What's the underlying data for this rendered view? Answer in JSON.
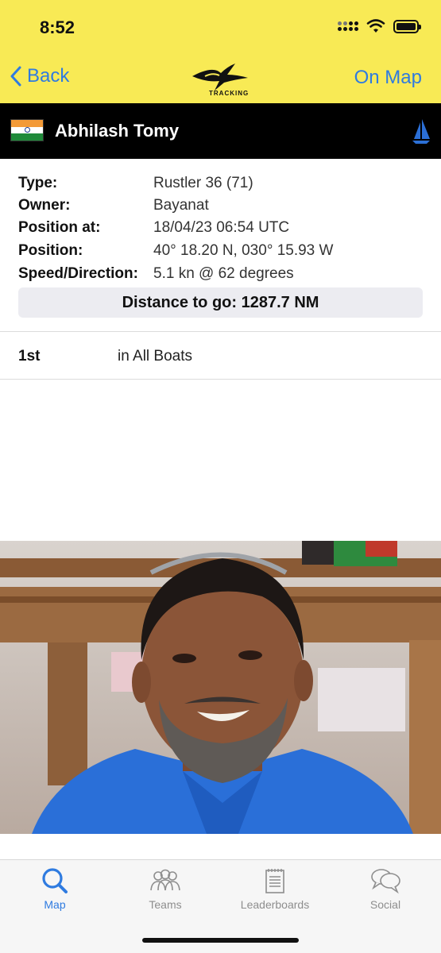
{
  "status_bar": {
    "time": "8:52"
  },
  "nav": {
    "back_label": "Back",
    "on_map_label": "On Map",
    "logo_text": "TRACKING",
    "accent_color": "#2f7be0",
    "bar_color": "#f8ea55"
  },
  "boat": {
    "name": "Abhilash Tomy",
    "flag_icon": "india-flag-icon",
    "boat_icon": "sailboat-icon"
  },
  "details": {
    "rows": [
      {
        "label": "Type:",
        "value": "Rustler 36 (71)"
      },
      {
        "label": "Owner:",
        "value": "Bayanat"
      },
      {
        "label": "Position at:",
        "value": "18/04/23 06:54 UTC"
      },
      {
        "label": "Position:",
        "value": "40° 18.20 N, 030° 15.93 W"
      },
      {
        "label": "Speed/Direction:",
        "value": "5.1 kn @ 62 degrees"
      }
    ],
    "distance_to_go": "Distance to go: 1287.7 NM"
  },
  "ranking": {
    "position": "1st",
    "group": "in All Boats"
  },
  "tabs": [
    {
      "label": "Map",
      "icon": "search-icon",
      "active": true
    },
    {
      "label": "Teams",
      "icon": "people-icon",
      "active": false
    },
    {
      "label": "Leaderboards",
      "icon": "notepad-icon",
      "active": false
    },
    {
      "label": "Social",
      "icon": "chat-bubbles-icon",
      "active": false
    }
  ]
}
